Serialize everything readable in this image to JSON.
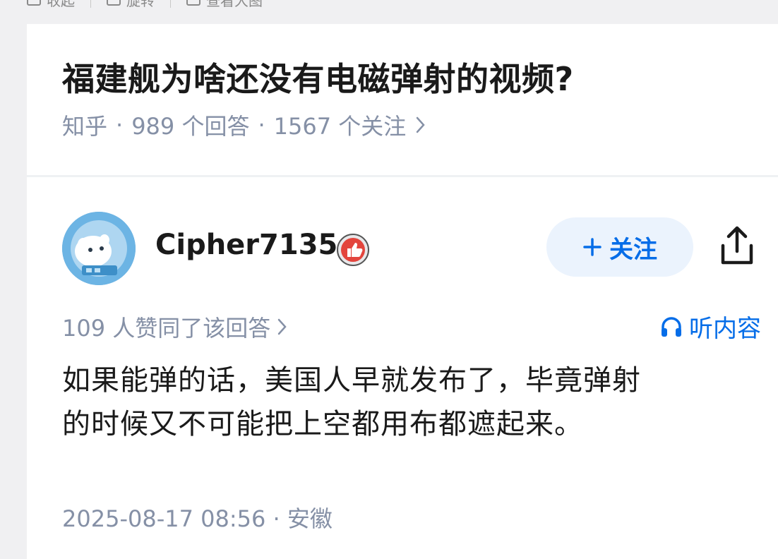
{
  "toolbar": {
    "collapse_label": "收起",
    "rotate_label": "旋转",
    "view_large_label": "查看大图"
  },
  "question": {
    "title": "福建舰为啥还没有电磁弹射的视频?",
    "source": "知乎",
    "answers": "989 个回答",
    "followers": "1567 个关注"
  },
  "author": {
    "name": "Cipher7135",
    "follow_label": "关注"
  },
  "answer": {
    "votes": "109 人赞同了该回答",
    "listen_label": "听内容",
    "content_line1": "如果能弹的话，美国人早就发布了，毕竟弹射",
    "content_line2": "的时候又不可能把上空都用布都遮起来。",
    "date": "2025-08-17 08:56",
    "location": "安徽"
  },
  "colors": {
    "accent": "#056de8",
    "meta_gray": "#8590a6",
    "follow_bg": "#ebf3fd"
  }
}
